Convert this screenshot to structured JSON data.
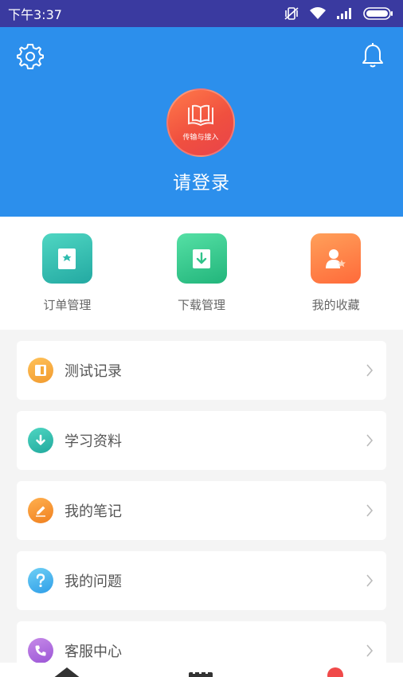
{
  "status_bar": {
    "time": "下午3:37",
    "icons": [
      "vibrate-off-icon",
      "wifi-icon",
      "signal-icon",
      "battery-icon"
    ]
  },
  "header": {
    "background_color": "#2c8fec",
    "settings_icon": "gear-icon",
    "notification_icon": "bell-icon",
    "avatar_text": "传输与接入",
    "login_prompt": "请登录"
  },
  "shortcuts": [
    {
      "label": "订单管理",
      "icon": "order-icon",
      "color": "#2fbcae"
    },
    {
      "label": "下载管理",
      "icon": "download-icon",
      "color": "#30c38a"
    },
    {
      "label": "我的收藏",
      "icon": "favorite-user-icon",
      "color": "#ff7a45"
    }
  ],
  "menu": [
    {
      "label": "测试记录",
      "icon": "notebook-icon",
      "color": "#f5a93a"
    },
    {
      "label": "学习资料",
      "icon": "download-circle-icon",
      "color": "#2fbcae"
    },
    {
      "label": "我的笔记",
      "icon": "pencil-icon",
      "color": "#f28c2a"
    },
    {
      "label": "我的问题",
      "icon": "question-icon",
      "color": "#3aa8ec"
    },
    {
      "label": "客服中心",
      "icon": "phone-icon",
      "color": "#a862dc"
    }
  ]
}
